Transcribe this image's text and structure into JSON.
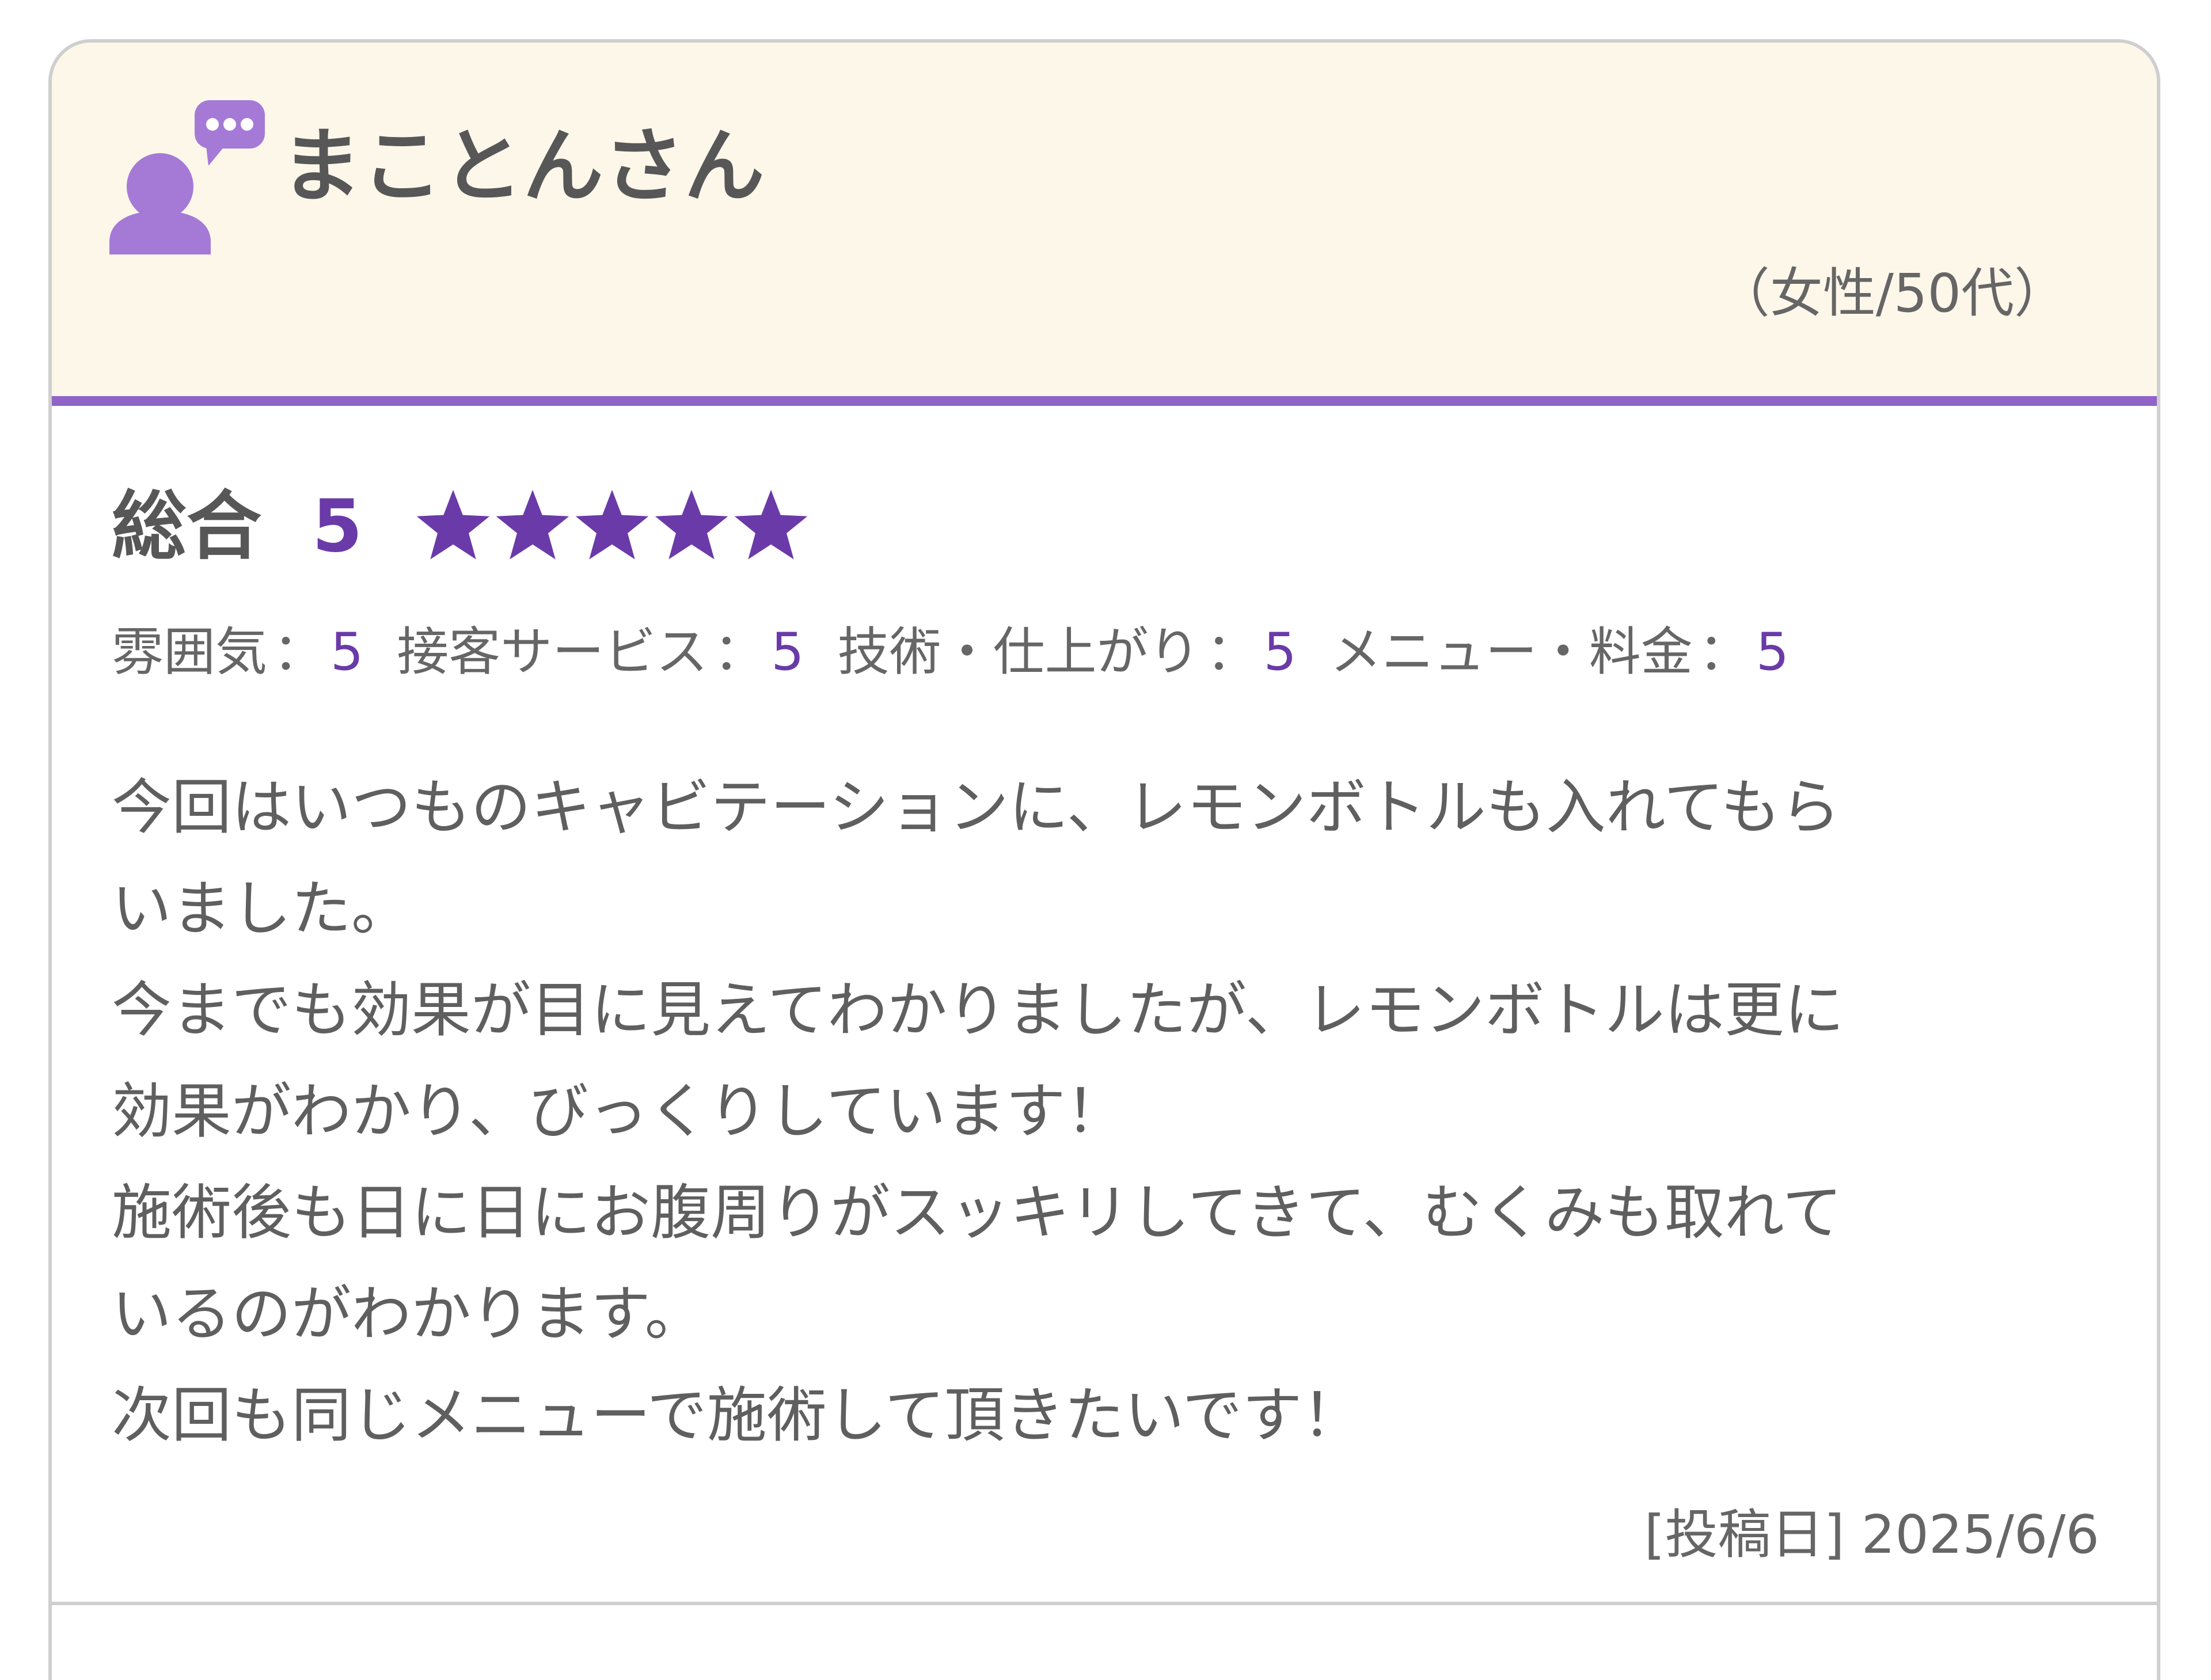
{
  "reviewer": {
    "name": "まことんさん",
    "demographic": "（女性/50代）",
    "icon": "user-comment-icon"
  },
  "rating": {
    "overall_label": "総合",
    "overall_score": "5",
    "stars_filled": 5,
    "stars_total": 5,
    "separator": "：",
    "categories": [
      {
        "label": "雰囲気",
        "value": "5"
      },
      {
        "label": "接客サービス",
        "value": "5"
      },
      {
        "label": "技術・仕上がり",
        "value": "5"
      },
      {
        "label": "メニュー・料金",
        "value": "5"
      }
    ]
  },
  "review": {
    "lines": [
      "今回はいつものキャビテーションに、レモンボトルも入れてもら",
      "いました。",
      "今までも効果が目に見えてわかりましたが、レモンボトルは更に",
      "効果がわかり、びっくりしています！",
      "施術後も日に日にお腹周りがスッキリしてきて、むくみも取れて",
      "いるのがわかります。",
      "次回も同じメニューで施術して頂きたいです！"
    ]
  },
  "posted": {
    "text": "[投稿日] 2025/6/6"
  },
  "colors": {
    "accent": "#8f63c8",
    "score": "#6a3aa8",
    "star": "#6a3aa8",
    "header_bg": "#fdf7ea",
    "icon": "#a57ad7"
  }
}
